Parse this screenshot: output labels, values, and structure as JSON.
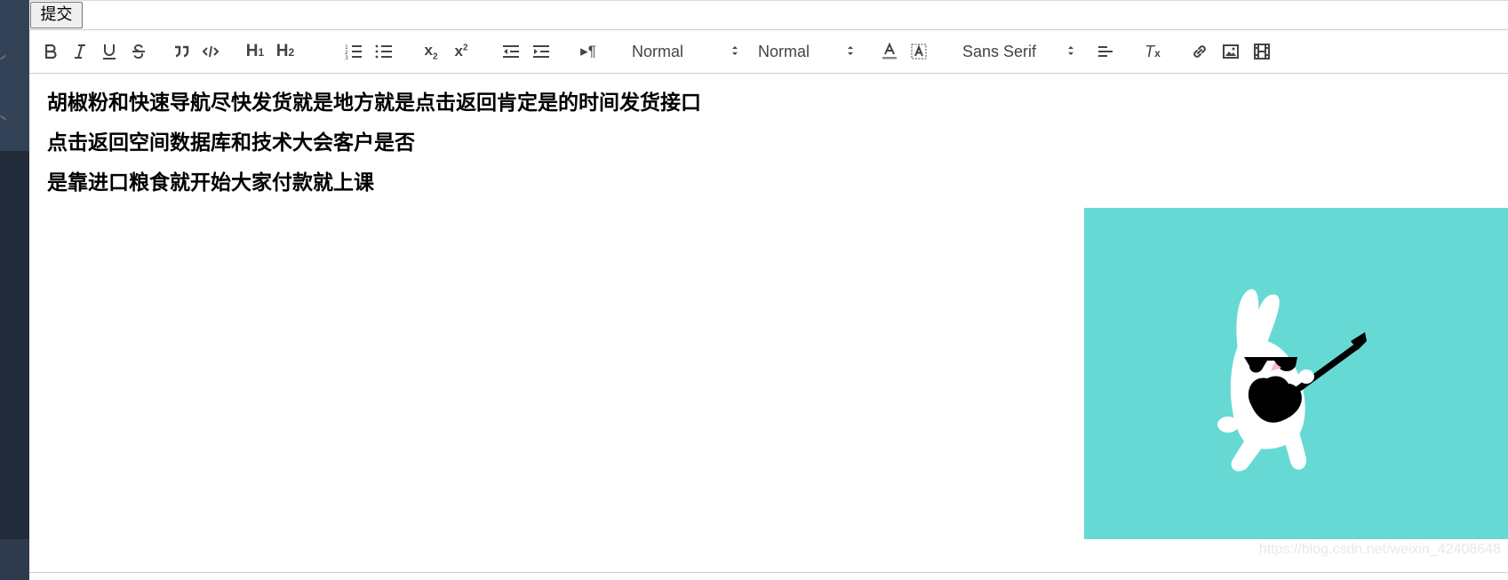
{
  "toolbar_top": {
    "submit_label": "提交"
  },
  "editor_toolbar": {
    "header_picker": "Normal",
    "size_picker": "Normal",
    "font_picker": "Sans Serif",
    "h1": "H1",
    "h2": "H2"
  },
  "content": {
    "lines": [
      "胡椒粉和快速导航尽快发货就是地方就是点击返回肯定是的时间发货接口",
      "点击返回空间数据库和技术大会客户是否",
      "是靠进口粮食就开始大家付款就上课"
    ],
    "image": {
      "description_icon": "rabbit-guitar-image"
    }
  },
  "watermark": "https://blog.csdn.net/weixin_42408648",
  "colors": {
    "image_bg": "#66d9d5",
    "sidebar": "#2a3546",
    "toolbar_icon": "#444444"
  }
}
